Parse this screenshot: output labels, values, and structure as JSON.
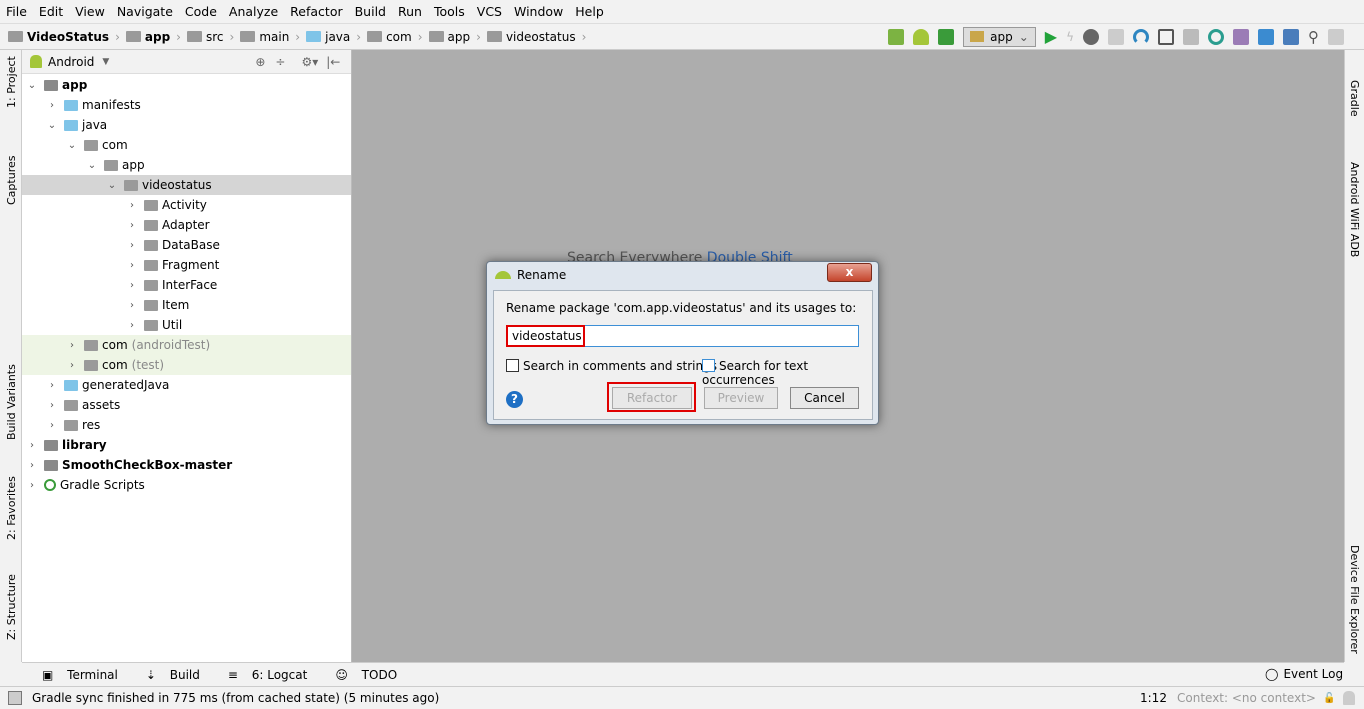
{
  "menu": [
    "File",
    "Edit",
    "View",
    "Navigate",
    "Code",
    "Analyze",
    "Refactor",
    "Build",
    "Run",
    "Tools",
    "VCS",
    "Window",
    "Help"
  ],
  "breadcrumb": [
    "VideoStatus",
    "app",
    "src",
    "main",
    "java",
    "com",
    "app",
    "videostatus"
  ],
  "toolbar": {
    "run_config": "app"
  },
  "left_strip": [
    "1: Project",
    "Captures",
    "Build Variants",
    "2: Favorites",
    "Z: Structure"
  ],
  "right_strip": [
    "Gradle",
    "Android WiFi ADB",
    "Device File Explorer"
  ],
  "panel": {
    "view": "Android"
  },
  "tree": [
    {
      "label": "app",
      "level": 0,
      "expanded": true,
      "bold": true,
      "icon": "module"
    },
    {
      "label": "manifests",
      "level": 1,
      "expanded": false,
      "icon": "folder-blue"
    },
    {
      "label": "java",
      "level": 1,
      "expanded": true,
      "icon": "folder-blue"
    },
    {
      "label": "com",
      "level": 2,
      "expanded": true,
      "icon": "package"
    },
    {
      "label": "app",
      "level": 3,
      "expanded": true,
      "icon": "package"
    },
    {
      "label": "videostatus",
      "level": 4,
      "expanded": true,
      "icon": "package",
      "selected": true
    },
    {
      "label": "Activity",
      "level": 5,
      "expanded": false,
      "icon": "package"
    },
    {
      "label": "Adapter",
      "level": 5,
      "expanded": false,
      "icon": "package"
    },
    {
      "label": "DataBase",
      "level": 5,
      "expanded": false,
      "icon": "package"
    },
    {
      "label": "Fragment",
      "level": 5,
      "expanded": false,
      "icon": "package"
    },
    {
      "label": "InterFace",
      "level": 5,
      "expanded": false,
      "icon": "package"
    },
    {
      "label": "Item",
      "level": 5,
      "expanded": false,
      "icon": "package"
    },
    {
      "label": "Util",
      "level": 5,
      "expanded": false,
      "icon": "package"
    },
    {
      "label": "com",
      "suffix": "(androidTest)",
      "level": 2,
      "expanded": false,
      "icon": "package",
      "test": true
    },
    {
      "label": "com",
      "suffix": "(test)",
      "level": 2,
      "expanded": false,
      "icon": "package",
      "test": true
    },
    {
      "label": "generatedJava",
      "level": 1,
      "expanded": false,
      "icon": "folder-blue"
    },
    {
      "label": "assets",
      "level": 1,
      "expanded": false,
      "icon": "folder"
    },
    {
      "label": "res",
      "level": 1,
      "expanded": false,
      "icon": "folder"
    },
    {
      "label": "library",
      "level": 0,
      "expanded": false,
      "bold": true,
      "icon": "module"
    },
    {
      "label": "SmoothCheckBox-master",
      "level": 0,
      "expanded": false,
      "bold": true,
      "icon": "module"
    },
    {
      "label": "Gradle Scripts",
      "level": 0,
      "expanded": false,
      "icon": "gradle"
    }
  ],
  "hint": {
    "text": "Search Everywhere",
    "shortcut": "Double Shift"
  },
  "dialog": {
    "title": "Rename",
    "prompt": "Rename package 'com.app.videostatus' and its usages to:",
    "value": "videostatus",
    "opt1": "Search in comments and strings",
    "opt2": "Search for text occurrences",
    "refactor": "Refactor",
    "preview": "Preview",
    "cancel": "Cancel",
    "help": "?",
    "close": "x"
  },
  "toolwindows": [
    "Terminal",
    "Build",
    "6: Logcat",
    "TODO"
  ],
  "event_log": "Event Log",
  "status": {
    "message": "Gradle sync finished in 775 ms (from cached state) (5 minutes ago)",
    "position": "1:12",
    "context": "Context: <no context>"
  },
  "colors": {
    "highlight": "#e00000",
    "main_bg": "#adadad",
    "android_green": "#a4c639"
  }
}
